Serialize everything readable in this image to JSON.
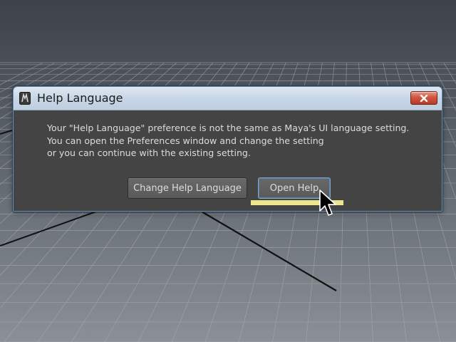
{
  "dialog": {
    "title": "Help Language",
    "close_icon": "close-icon",
    "app_icon": "maya-app-icon",
    "message_lines": [
      "Your \"Help Language\" preference is not the same as Maya's UI language setting.",
      "You can open the Preferences window and change the setting",
      "or you can continue with the existing setting."
    ],
    "buttons": {
      "change_help_language": "Change Help Language",
      "open_help": "Open Help"
    }
  },
  "colors": {
    "dialog_bg": "#444444",
    "titlebar": "#c7d6e6",
    "close_button": "#d0563f",
    "highlight": "#ede48e",
    "focused_button_border": "#7ea3cc"
  },
  "viewport": {
    "grid": "perspective-grid"
  }
}
